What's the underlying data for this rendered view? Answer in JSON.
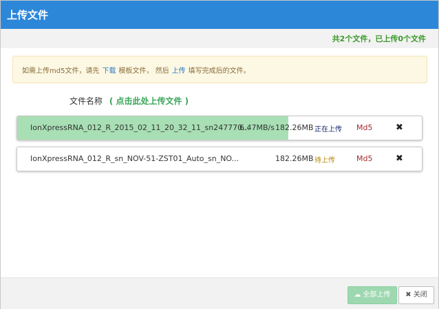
{
  "dialog": {
    "title": "上传文件",
    "summary": "共2个文件，已上传0个文件"
  },
  "notice": {
    "text_before": "如需上传md5文件，请先",
    "download_link": "下载",
    "text_middle": "模板文件， 然后",
    "upload_link": "上传",
    "text_after": "填写完成后的文件。"
  },
  "file_list": {
    "header_label": "文件名称",
    "upload_link": "( 点击此处上传文件 )",
    "files": [
      {
        "name": "IonXpressRNA_012_R_2015_02_11_20_32_11_sn247770...",
        "speed": "6.47MB/s",
        "size": "182.26MB",
        "status": "正在上传",
        "md5": "Md5",
        "remove_icon": "close-icon",
        "progress_fraction": 0.67
      },
      {
        "name": "IonXpressRNA_012_R_sn_NOV-51-ZST01_Auto_sn_NO...",
        "speed": "",
        "size": "182.26MB",
        "status": "待上传",
        "md5": "Md5",
        "remove_icon": "close-icon",
        "progress_fraction": 0
      }
    ]
  },
  "footer": {
    "upload_all_label": "全部上传",
    "upload_all_icon": "cloud-upload-icon",
    "close_label": "关闭",
    "close_icon": "close-icon"
  },
  "colors": {
    "header": "#2d87d9",
    "progress": "#a8dfb4",
    "summary_text": "#3a9a2a",
    "md5": "#a52a2a"
  }
}
